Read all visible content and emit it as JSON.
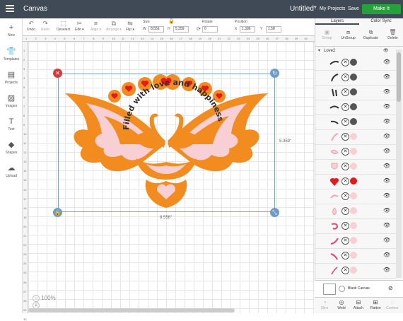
{
  "topbar": {
    "title": "Canvas",
    "document": "Untitled*",
    "my_projects": "My Projects",
    "save": "Save",
    "make_it": "Make It"
  },
  "leftnav": [
    {
      "label": "New",
      "icon": "+"
    },
    {
      "label": "Templates",
      "icon": "👕"
    },
    {
      "label": "Projects",
      "icon": "▤"
    },
    {
      "label": "Images",
      "icon": "▨"
    },
    {
      "label": "Text",
      "icon": "T"
    },
    {
      "label": "Shapes",
      "icon": "◆"
    },
    {
      "label": "Upload",
      "icon": "☁"
    }
  ],
  "toolbar": {
    "undo": "Undo",
    "redo": "Redo",
    "deselect": "Deselect",
    "edit": "Edit",
    "align": "Align",
    "arrange": "Arrange",
    "flip": "Flip",
    "size_label": "Size",
    "w_label": "W",
    "w_value": "8.556",
    "h_label": "H",
    "h_value": "5.359",
    "rotate_label": "Rotate",
    "rotate_value": "0",
    "position_label": "Position",
    "x_label": "X",
    "x_value": "1.396",
    "y_label": "Y",
    "y_value": "1.58"
  },
  "rulers": {
    "top": [
      "1",
      "2",
      "3",
      "4",
      "5",
      "6",
      "7",
      "8",
      "9",
      "10",
      "11",
      "12",
      "13",
      "14",
      "15",
      "16",
      "17",
      "18",
      "19",
      "20",
      "21",
      "22",
      "23",
      "24",
      "25",
      "26",
      "27",
      "28",
      "29",
      "30"
    ],
    "left": [
      "1",
      "2",
      "3",
      "4",
      "5",
      "6",
      "7",
      "8",
      "9",
      "10",
      "11",
      "12",
      "13",
      "14",
      "15",
      "16",
      "17",
      "18",
      "19",
      "20",
      "21",
      "22",
      "23",
      "24",
      "25",
      "26",
      "27",
      "28",
      "29",
      "30"
    ]
  },
  "canvas": {
    "width_dim": "8.556\"",
    "height_dim": "5.359\"",
    "zoom": "100%",
    "artwork_text": "Filled with love and happiness",
    "colors": {
      "orange": "#f28c1e",
      "pink": "#f9cfd6",
      "red": "#e8191c",
      "selection": "#7da2c8"
    }
  },
  "panel": {
    "tabs": [
      "Layers",
      "Color Sync"
    ],
    "actions": [
      "Group",
      "UnGroup",
      "Duplicate",
      "Delete"
    ],
    "group_name": "Love2",
    "layers": [
      {
        "thumb": "text-1",
        "color": "#555555"
      },
      {
        "thumb": "text-2",
        "color": "#555555"
      },
      {
        "thumb": "text-3",
        "color": "#555555"
      },
      {
        "thumb": "text-4",
        "color": "#555555"
      },
      {
        "thumb": "text-5",
        "color": "#555555"
      },
      {
        "thumb": "curve-pink",
        "color": "#f9cfd6"
      },
      {
        "thumb": "wing-pink",
        "color": "#f9cfd6"
      },
      {
        "thumb": "shield-pink",
        "color": "#f9cfd6"
      },
      {
        "thumb": "heart-red",
        "color": "#e8191c"
      },
      {
        "thumb": "wave-pink",
        "color": "#f9cfd6"
      },
      {
        "thumb": "drop-pink",
        "color": "#f9cfd6"
      },
      {
        "thumb": "hook-pink",
        "color": "#f9cfd6"
      },
      {
        "thumb": "leaf-pink",
        "color": "#f9cfd6"
      },
      {
        "thumb": "feather-pink",
        "color": "#f9cfd6"
      },
      {
        "thumb": "stroke-pink",
        "color": "#f9cfd6"
      },
      {
        "thumb": "arc-pink",
        "color": "#f9cfd6"
      }
    ],
    "blank_canvas": "Blank Canvas",
    "bottom": [
      "Slice",
      "Weld",
      "Attach",
      "Flatten",
      "Contour"
    ]
  }
}
